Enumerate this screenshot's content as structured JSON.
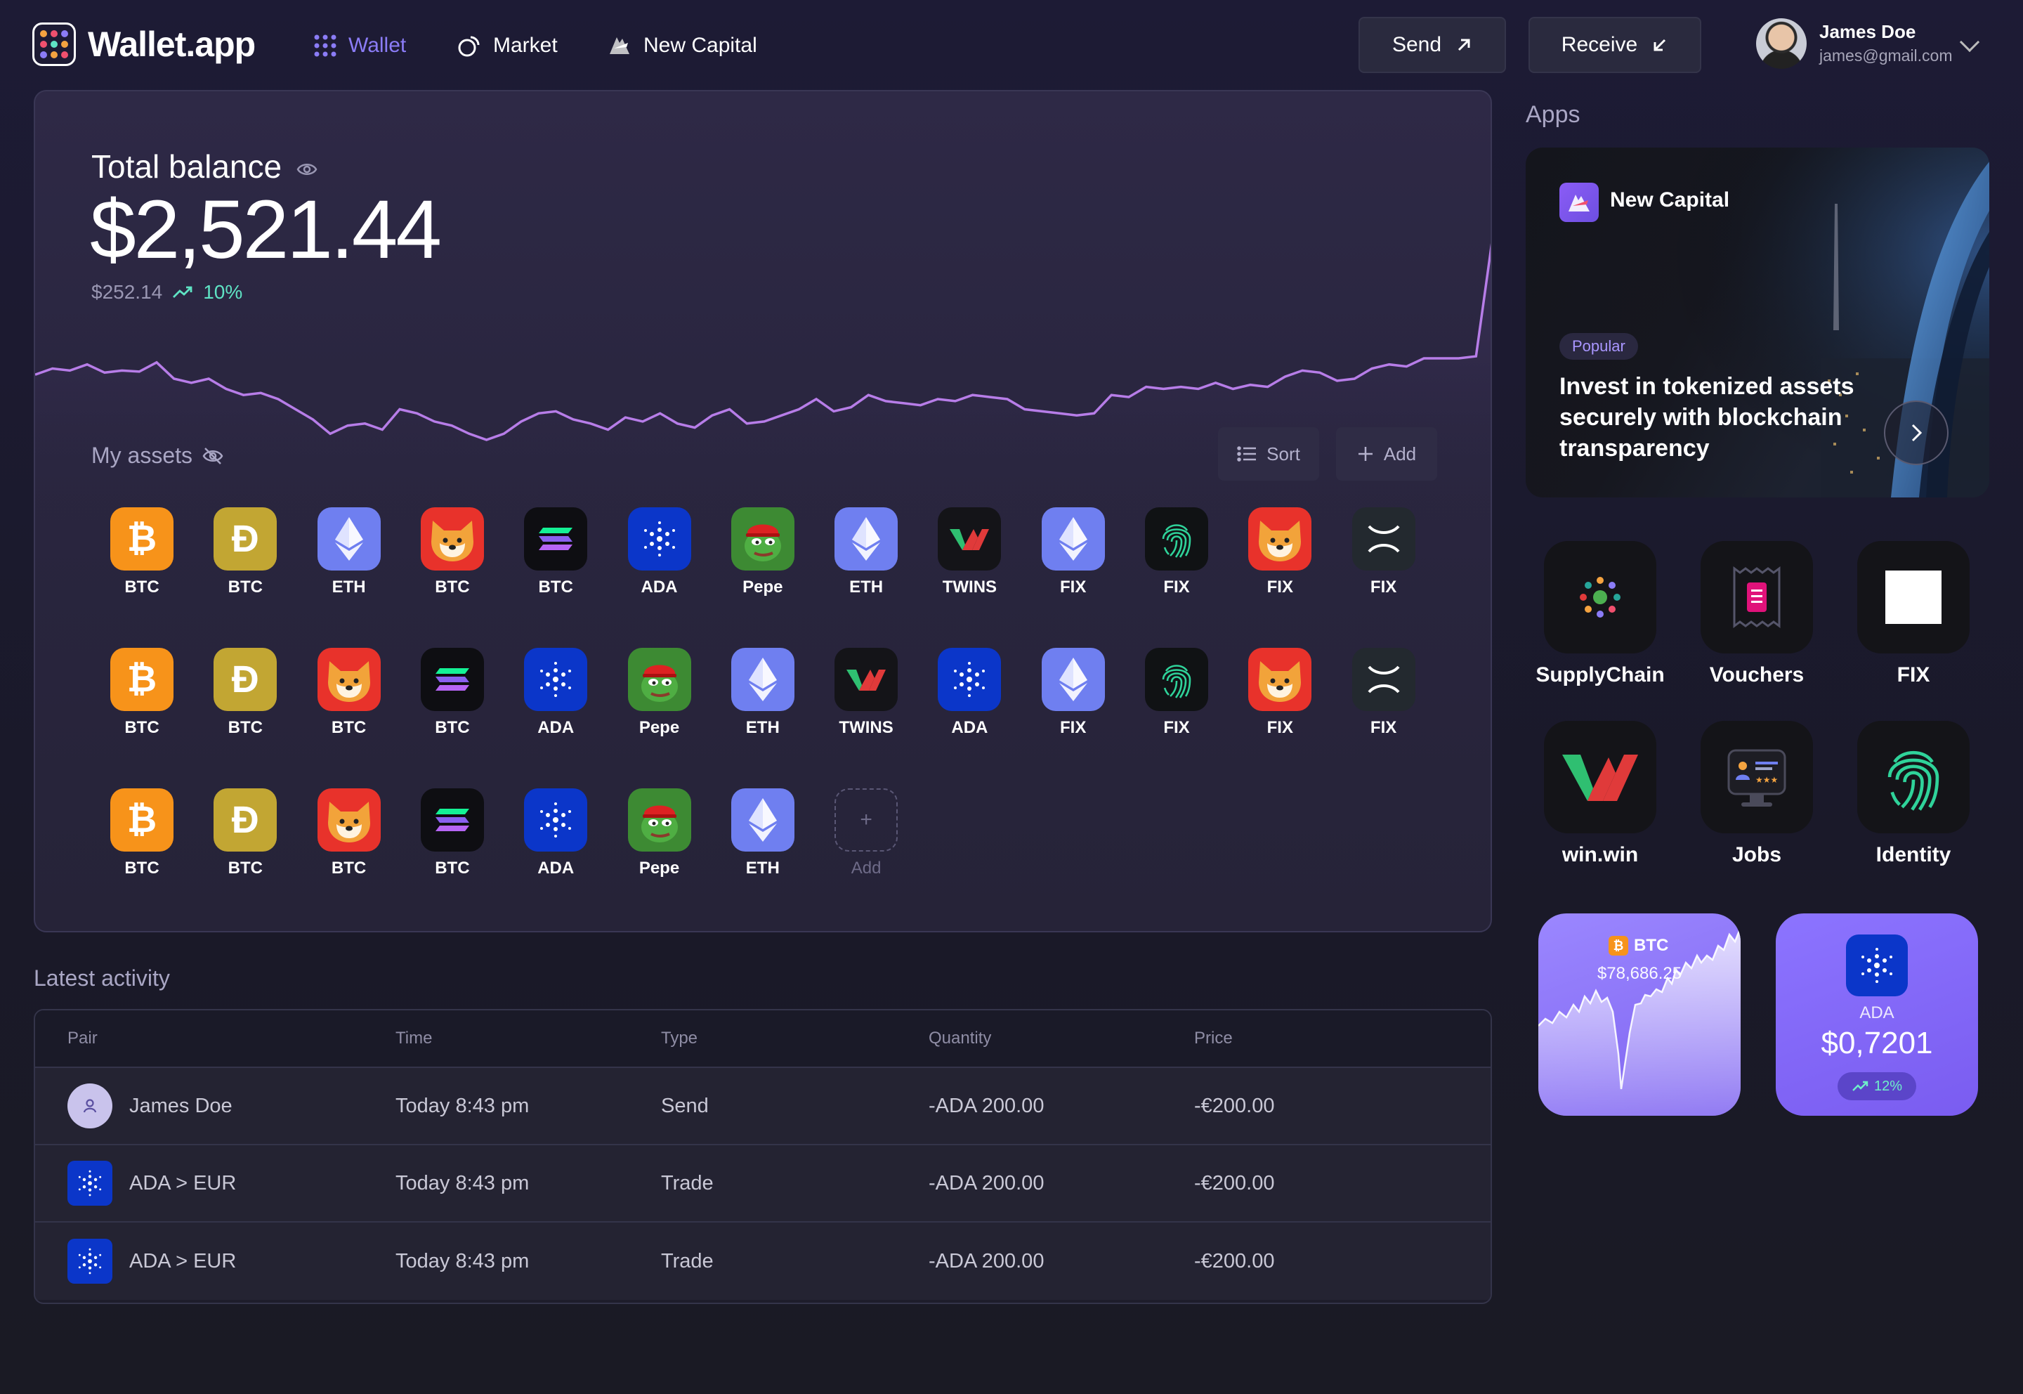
{
  "header": {
    "brand": "Wallet.app",
    "nav": [
      {
        "label": "Wallet",
        "icon": "grid-dots-icon",
        "active": true
      },
      {
        "label": "Market",
        "icon": "market-icon",
        "active": false
      },
      {
        "label": "New Capital",
        "icon": "new-capital-icon",
        "active": false
      }
    ],
    "send_label": "Send",
    "receive_label": "Receive",
    "user": {
      "name": "James Doe",
      "email": "james@gmail.com"
    }
  },
  "balance": {
    "label": "Total balance",
    "value": "$2,521.44",
    "change_amount": "$252.14",
    "change_percent": "10%",
    "chart": [
      16,
      10,
      12,
      6,
      14,
      12,
      13,
      4,
      20,
      24,
      20,
      30,
      36,
      34,
      40,
      50,
      60,
      74,
      66,
      64,
      70,
      50,
      54,
      62,
      66,
      74,
      80,
      74,
      62,
      54,
      52,
      60,
      64,
      70,
      58,
      62,
      54,
      64,
      68,
      56,
      50,
      64,
      62,
      56,
      50,
      40,
      52,
      48,
      36,
      42,
      44,
      46,
      40,
      42,
      36,
      38,
      40,
      50,
      52,
      54,
      56,
      54,
      36,
      38,
      28,
      30,
      28,
      30,
      24,
      30,
      26,
      28,
      18,
      12,
      14,
      22,
      20,
      10,
      6,
      8,
      0,
      0,
      0,
      -2,
      -4
    ]
  },
  "assets": {
    "label": "My assets",
    "sort_label": "Sort",
    "add_label": "Add",
    "rows": [
      [
        {
          "label": "BTC",
          "icon": "bitcoin-icon"
        },
        {
          "label": "BTC",
          "icon": "dogecoin-icon"
        },
        {
          "label": "ETH",
          "icon": "ethereum-icon"
        },
        {
          "label": "BTC",
          "icon": "shiba-icon"
        },
        {
          "label": "BTC",
          "icon": "solana-icon"
        },
        {
          "label": "ADA",
          "icon": "cardano-icon"
        },
        {
          "label": "Pepe",
          "icon": "pepe-icon"
        },
        {
          "label": "ETH",
          "icon": "ethereum-icon"
        },
        {
          "label": "TWINS",
          "icon": "twins-icon"
        },
        {
          "label": "FIX",
          "icon": "ethereum-icon"
        },
        {
          "label": "FIX",
          "icon": "fingerprint-icon"
        },
        {
          "label": "FIX",
          "icon": "shiba-icon"
        },
        {
          "label": "FIX",
          "icon": "xrp-icon"
        }
      ],
      [
        {
          "label": "BTC",
          "icon": "bitcoin-icon"
        },
        {
          "label": "BTC",
          "icon": "dogecoin-icon"
        },
        {
          "label": "BTC",
          "icon": "shiba-icon"
        },
        {
          "label": "BTC",
          "icon": "solana-icon"
        },
        {
          "label": "ADA",
          "icon": "cardano-icon"
        },
        {
          "label": "Pepe",
          "icon": "pepe-icon"
        },
        {
          "label": "ETH",
          "icon": "ethereum-icon"
        },
        {
          "label": "TWINS",
          "icon": "twins-icon"
        },
        {
          "label": "ADA",
          "icon": "cardano-icon"
        },
        {
          "label": "FIX",
          "icon": "ethereum-icon"
        },
        {
          "label": "FIX",
          "icon": "fingerprint-icon"
        },
        {
          "label": "FIX",
          "icon": "shiba-icon"
        },
        {
          "label": "FIX",
          "icon": "xrp-icon"
        }
      ],
      [
        {
          "label": "BTC",
          "icon": "bitcoin-icon"
        },
        {
          "label": "BTC",
          "icon": "dogecoin-icon"
        },
        {
          "label": "BTC",
          "icon": "shiba-icon"
        },
        {
          "label": "BTC",
          "icon": "solana-icon"
        },
        {
          "label": "ADA",
          "icon": "cardano-icon"
        },
        {
          "label": "Pepe",
          "icon": "pepe-icon"
        },
        {
          "label": "ETH",
          "icon": "ethereum-icon"
        },
        {
          "label": "Add",
          "icon": "add-icon"
        }
      ]
    ]
  },
  "activity": {
    "label": "Latest activity",
    "columns": [
      "Pair",
      "Time",
      "Type",
      "Quantity",
      "Price"
    ],
    "rows": [
      {
        "avatar": "user-icon",
        "pair": "James Doe",
        "time": "Today 8:43 pm",
        "type": "Send",
        "quantity": "-ADA 200.00",
        "price": "-€200.00"
      },
      {
        "avatar": "cardano-icon",
        "pair": "ADA > EUR",
        "time": "Today 8:43 pm",
        "type": "Trade",
        "quantity": "-ADA 200.00",
        "price": "-€200.00"
      },
      {
        "avatar": "cardano-icon",
        "pair": "ADA > EUR",
        "time": "Today 8:43 pm",
        "type": "Trade",
        "quantity": "-ADA 200.00",
        "price": "-€200.00"
      }
    ]
  },
  "apps": {
    "label": "Apps",
    "promo": {
      "title": "New Capital",
      "badge": "Popular",
      "text": "Invest in tokenized assets securely with blockchain transparency"
    },
    "grid": [
      {
        "label": "SupplyChain",
        "icon": "supplychain-icon"
      },
      {
        "label": "Vouchers",
        "icon": "voucher-icon"
      },
      {
        "label": "FIX",
        "icon": "fix-square-icon"
      },
      {
        "label": "win.win",
        "icon": "winwin-icon"
      },
      {
        "label": "Jobs",
        "icon": "jobs-icon"
      },
      {
        "label": "Identity",
        "icon": "fingerprint-icon"
      }
    ],
    "widgets": {
      "btc": {
        "symbol": "BTC",
        "price": "$78,686.25"
      },
      "ada": {
        "symbol": "ADA",
        "price": "$0,7201",
        "change": "12%"
      }
    }
  },
  "colors": {
    "accent": "#8b7cf6",
    "positive": "#5fe3c4",
    "chart_line": "#b77de8"
  }
}
